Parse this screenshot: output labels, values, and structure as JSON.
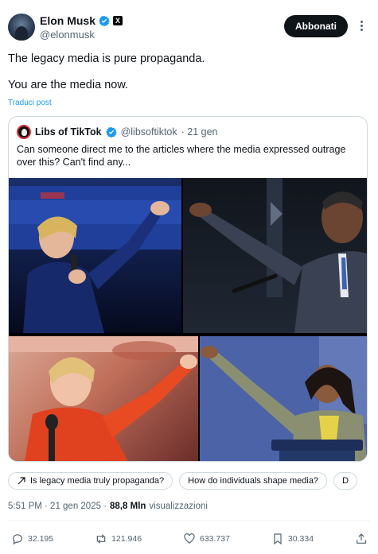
{
  "author": {
    "name": "Elon Musk",
    "handle": "@elonmusk",
    "follow_label": "Abbonati",
    "verified_badge_color": "#1d9bf0",
    "affiliate_badge": "X"
  },
  "tweet": {
    "line1": "The legacy media is pure propaganda.",
    "line2": "You are the media now.",
    "translate_label": "Traduci post"
  },
  "quoted": {
    "name": "Libs of TikTok",
    "handle": "@libsoftiktok",
    "date": "· 21 gen",
    "text": "Can someone direct me to the articles where the media expressed outrage over this? Can't find any..."
  },
  "suggestions": [
    {
      "label": "Is legacy media truly propaganda?"
    },
    {
      "label": "How do individuals shape media?"
    },
    {
      "label": "D"
    }
  ],
  "meta": {
    "time_date": "5:51 PM · 21 gen 2025 ·",
    "views_count": "88,8 Mln",
    "views_label": "visualizzazioni"
  },
  "actions": {
    "replies": "32.195",
    "reposts": "121.946",
    "likes": "633.737",
    "bookmarks": "30.334"
  },
  "colors": {
    "accent": "#1d9bf0",
    "text": "#0f1419",
    "muted": "#536471"
  }
}
